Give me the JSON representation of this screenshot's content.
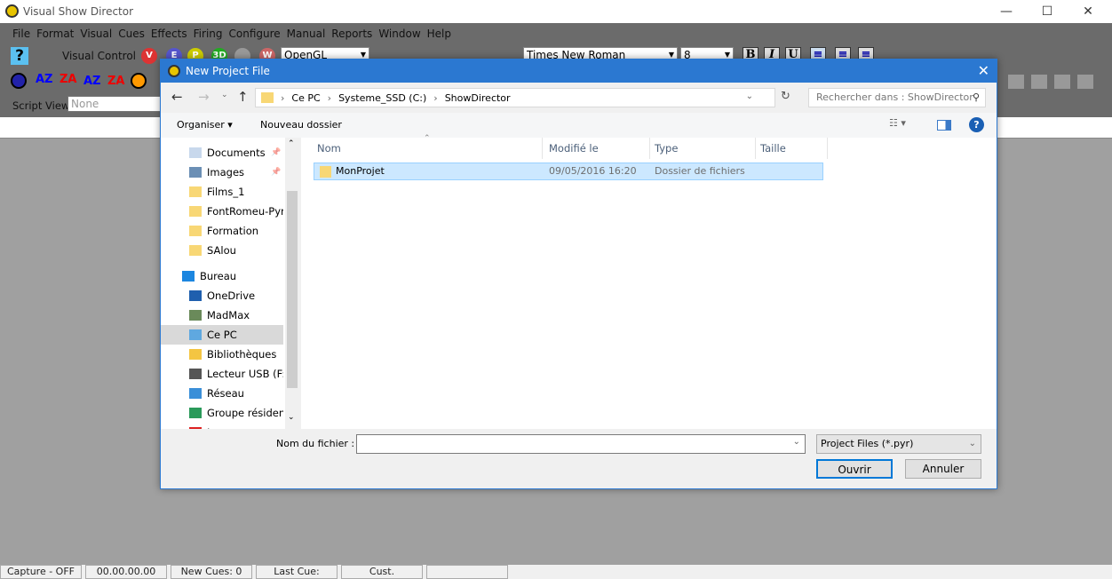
{
  "app": {
    "title": "Visual Show Director",
    "window_controls": [
      "minimize",
      "maximize",
      "close"
    ]
  },
  "menu": [
    "File",
    "Format",
    "Visual",
    "Cues",
    "Effects",
    "Firing",
    "Configure",
    "Manual",
    "Reports",
    "Window",
    "Help"
  ],
  "toolbar": {
    "visual_control": "Visual Control",
    "renderer": "OpenGL",
    "font": "Times New Roman",
    "font_size": "8",
    "circle_buttons": [
      "V",
      "E",
      "P",
      "3D",
      "",
      "W"
    ],
    "format_buttons": [
      "B",
      "I",
      "U"
    ],
    "sort_buttons": [
      "AZ",
      "ZA",
      "AZ",
      "ZA"
    ],
    "script_view_label": "Script View",
    "script_view_value": "None"
  },
  "status": [
    "Capture - OFF",
    "00.00.00.00",
    "New Cues: 0",
    "Last Cue:",
    "Cust.",
    ""
  ],
  "dialog": {
    "title": "New Project File",
    "breadcrumb": [
      "Ce PC",
      "Systeme_SSD (C:)",
      "ShowDirector"
    ],
    "search_placeholder": "Rechercher dans : ShowDirector",
    "organize": "Organiser",
    "new_folder": "Nouveau dossier",
    "nav": [
      {
        "label": "Documents",
        "icon": "documents-icon",
        "pinned": true
      },
      {
        "label": "Images",
        "icon": "images-icon",
        "pinned": true
      },
      {
        "label": "Films_1",
        "icon": "folder-icon"
      },
      {
        "label": "FontRomeu-Pyr",
        "icon": "folder-icon"
      },
      {
        "label": "Formation",
        "icon": "folder-icon"
      },
      {
        "label": "SAlou",
        "icon": "folder-icon"
      },
      {
        "label": "Bureau",
        "icon": "desktop-icon"
      },
      {
        "label": "OneDrive",
        "icon": "cloud-icon"
      },
      {
        "label": "MadMax",
        "icon": "user-icon"
      },
      {
        "label": "Ce PC",
        "icon": "computer-icon",
        "selected": true
      },
      {
        "label": "Bibliothèques",
        "icon": "library-icon"
      },
      {
        "label": "Lecteur USB (F:)",
        "icon": "usb-drive-icon"
      },
      {
        "label": "Réseau",
        "icon": "network-icon"
      },
      {
        "label": "Groupe résidenti",
        "icon": "homegroup-icon"
      },
      {
        "label": "Jeux",
        "icon": "games-icon"
      }
    ],
    "columns": [
      "Nom",
      "Modifié le",
      "Type",
      "Taille"
    ],
    "files": [
      {
        "name": "MonProjet",
        "modified": "09/05/2016 16:20",
        "type": "Dossier de fichiers",
        "size": ""
      }
    ],
    "filename_label": "Nom du fichier :",
    "filename_value": "",
    "filter": "Project Files (*.pyr)",
    "open": "Ouvrir",
    "cancel": "Annuler"
  },
  "colors": {
    "accent": "#2b78d1",
    "selection": "#cce8ff",
    "app_gray": "#6b6b6b"
  }
}
